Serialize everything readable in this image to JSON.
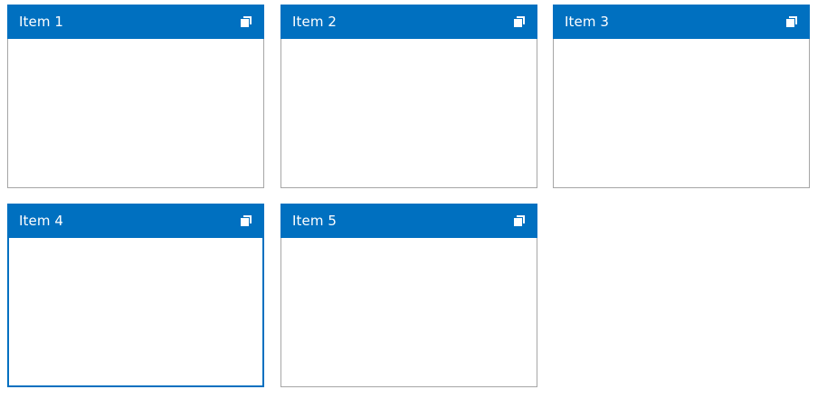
{
  "colors": {
    "header_background": "#0070c0",
    "header_text": "#ffffff",
    "tile_border": "#a6a6a6",
    "selected_border": "#0070c0"
  },
  "tiles": [
    {
      "title": "Item 1",
      "icon": "restore-window-icon"
    },
    {
      "title": "Item 2",
      "icon": "restore-window-icon"
    },
    {
      "title": "Item 3",
      "icon": "restore-window-icon"
    },
    {
      "title": "Item 4",
      "icon": "restore-window-icon",
      "selected": true
    },
    {
      "title": "Item 5",
      "icon": "restore-window-icon"
    }
  ]
}
